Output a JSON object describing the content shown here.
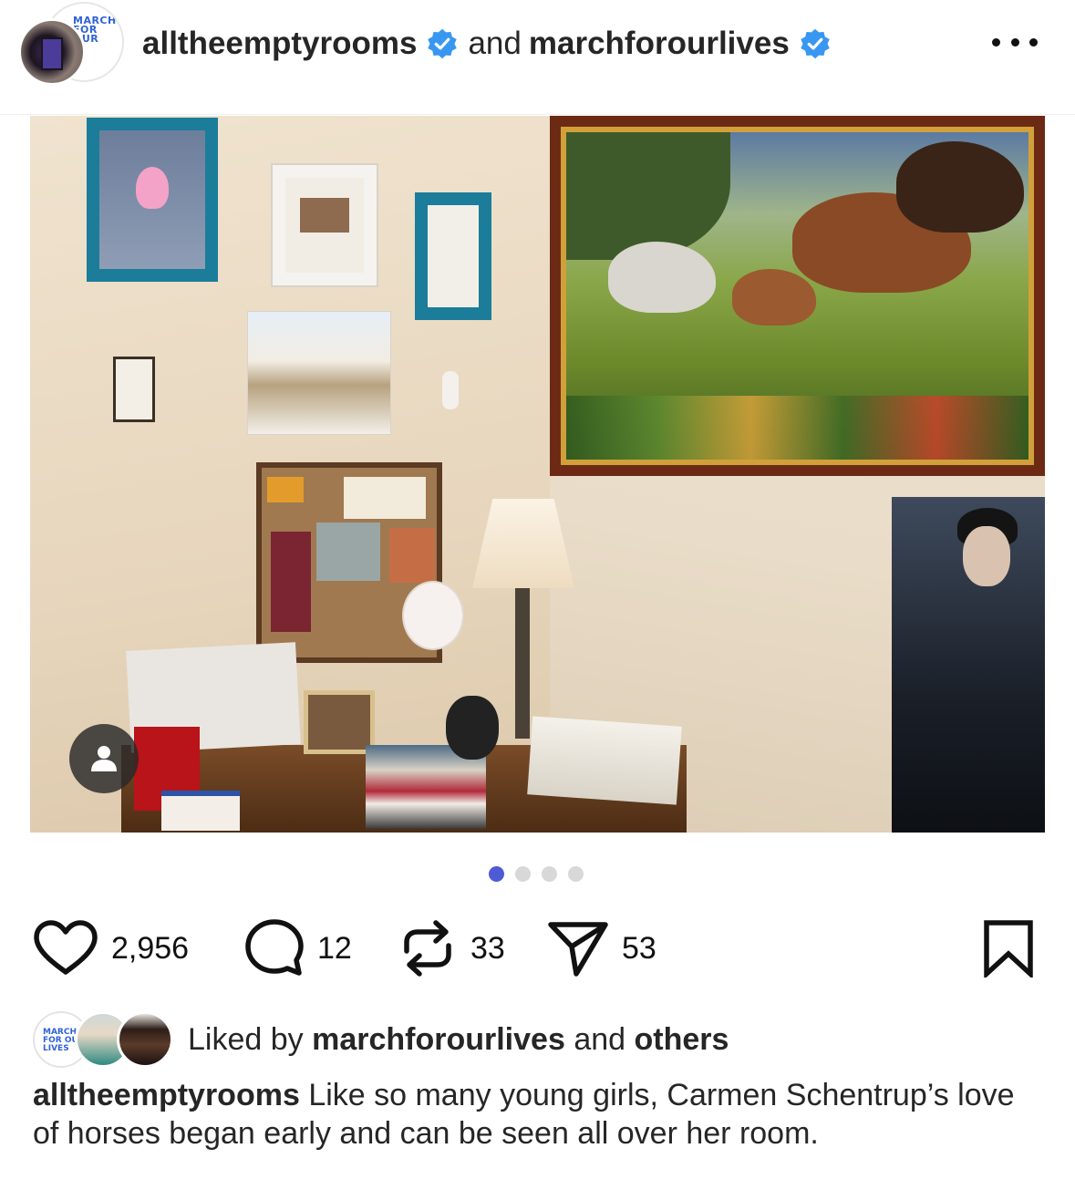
{
  "header": {
    "avatar_back_text": "MARCH FOR OUR",
    "account_1": "alltheemptyrooms",
    "connector": "and",
    "account_2": "marchforourlives",
    "verified_color": "#3897f0",
    "more_icon": "more-horizontal-icon"
  },
  "post": {
    "carousel": {
      "total": 4,
      "active_index": 0,
      "active_color": "#4f5bd5"
    },
    "profile_tag_icon": "user-icon"
  },
  "actions": {
    "likes": "2,956",
    "comments": "12",
    "reposts": "33",
    "shares": "53",
    "icons": [
      "heart-icon",
      "comment-icon",
      "repost-icon",
      "send-icon",
      "bookmark-icon"
    ]
  },
  "liked_by": {
    "avatar_logo_text": "MARCH FOR OUR LIVES",
    "prefix": "Liked by",
    "user": "marchforourlives",
    "middle": "and",
    "others": "others"
  },
  "caption": {
    "username": "alltheemptyrooms",
    "text": "Like so many young girls, Carmen Schentrup’s love of horses began early and can be seen all over her room."
  }
}
